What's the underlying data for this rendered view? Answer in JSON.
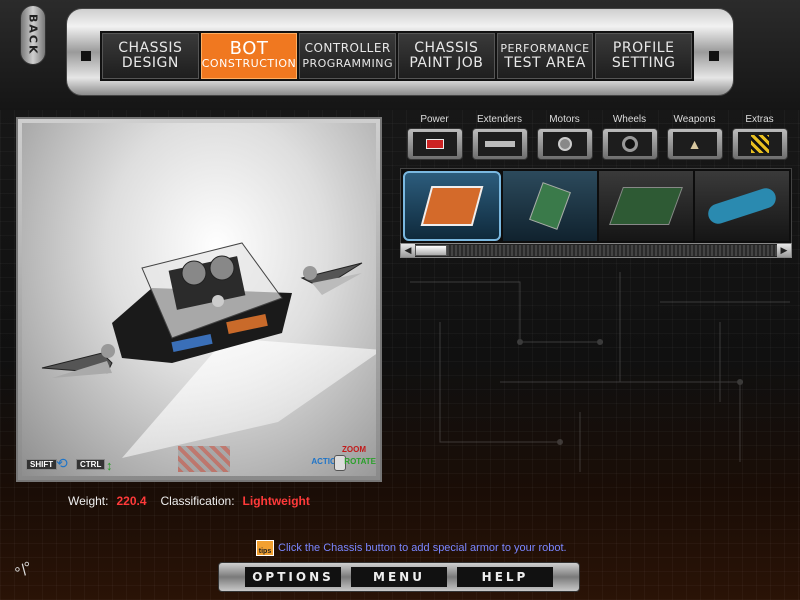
{
  "nav": {
    "back_label": "BACK",
    "tabs": [
      {
        "line1": "CHASSIS",
        "line2": "DESIGN",
        "active": false
      },
      {
        "line1": "BOT",
        "line2": "CONSTRUCTION",
        "active": true
      },
      {
        "line1": "CONTROLLER",
        "line2": "PROGRAMMING",
        "active": false
      },
      {
        "line1": "CHASSIS",
        "line2": "PAINT JOB",
        "active": false
      },
      {
        "line1": "PERFORMANCE",
        "line2": "TEST AREA",
        "active": false
      },
      {
        "line1": "PROFILE",
        "line2": "SETTING",
        "active": false
      }
    ]
  },
  "viewport": {
    "shift_label": "SHIFT",
    "ctrl_label": "CTRL",
    "action_label": "ACTION",
    "zoom_label": "ZOOM",
    "rotate_label": "ROTATE"
  },
  "stats": {
    "weight_label": "Weight:",
    "weight_value": "220.4",
    "class_label": "Classification:",
    "class_value": "Lightweight"
  },
  "categories": [
    {
      "label": "Power",
      "icon": "battery-icon"
    },
    {
      "label": "Extenders",
      "icon": "extender-bar-icon"
    },
    {
      "label": "Motors",
      "icon": "motor-icon"
    },
    {
      "label": "Wheels",
      "icon": "wheel-icon"
    },
    {
      "label": "Weapons",
      "icon": "weapon-icon"
    },
    {
      "label": "Extras",
      "icon": "hazard-icon"
    }
  ],
  "parts": [
    {
      "icon": "orange-circuit-board-icon",
      "selected": true
    },
    {
      "icon": "green-circuit-board-icon",
      "selected": false
    },
    {
      "icon": "large-circuit-board-icon",
      "selected": false
    },
    {
      "icon": "blue-canister-icon",
      "selected": false
    }
  ],
  "scroll": {
    "position": 0.0
  },
  "tip": {
    "icon_label": "tips",
    "text": "Click the Chassis button to add special armor to your robot."
  },
  "bottom": {
    "options_label": "OPTIONS",
    "menu_label": "MENU",
    "help_label": "HELP"
  },
  "colors": {
    "accent_orange": "#f07820",
    "stat_red": "#ff3a3a",
    "tip_blue": "#7a86ff"
  }
}
